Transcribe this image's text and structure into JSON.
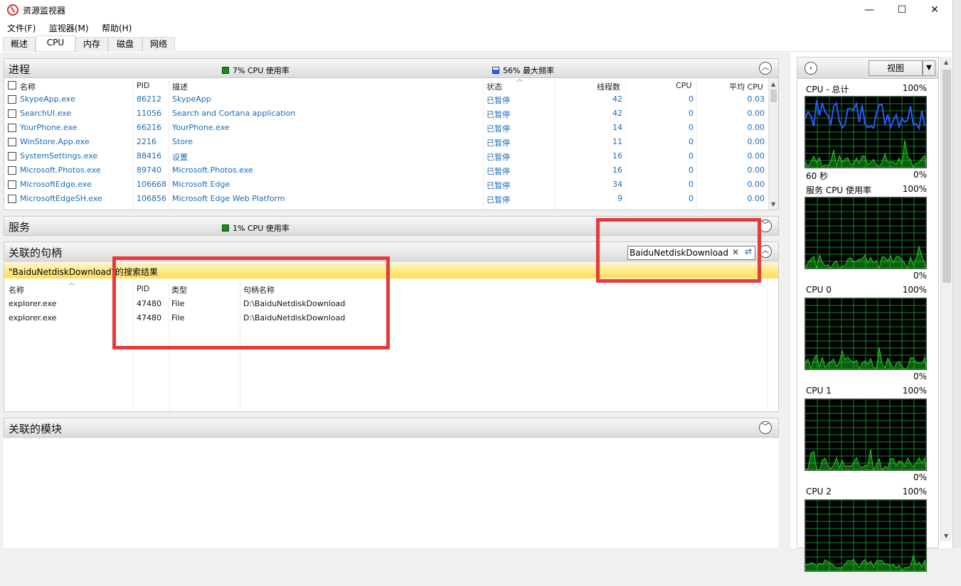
{
  "window": {
    "title": "资源监视器",
    "minimize": "—",
    "maximize": "☐",
    "close": "✕"
  },
  "menu": [
    "文件(F)",
    "监视器(M)",
    "帮助(H)"
  ],
  "tabs": [
    "概述",
    "CPU",
    "内存",
    "磁盘",
    "网络"
  ],
  "active_tab": "CPU",
  "processes": {
    "title": "进程",
    "cpu_usage": "7% CPU 使用率",
    "max_freq": "56% 最大频率",
    "columns": [
      "名称",
      "PID",
      "描述",
      "状态",
      "线程数",
      "CPU",
      "平均 CPU"
    ],
    "rows": [
      [
        "SkypeApp.exe",
        "86212",
        "SkypeApp",
        "已暂停",
        "42",
        "0",
        "0.03"
      ],
      [
        "SearchUI.exe",
        "11056",
        "Search and Cortana application",
        "已暂停",
        "42",
        "0",
        "0.00"
      ],
      [
        "YourPhone.exe",
        "66216",
        "YourPhone.exe",
        "已暂停",
        "14",
        "0",
        "0.00"
      ],
      [
        "WinStore.App.exe",
        "2216",
        "Store",
        "已暂停",
        "11",
        "0",
        "0.00"
      ],
      [
        "SystemSettings.exe",
        "88416",
        "设置",
        "已暂停",
        "16",
        "0",
        "0.00"
      ],
      [
        "Microsoft.Photos.exe",
        "89740",
        "Microsoft.Photos.exe",
        "已暂停",
        "16",
        "0",
        "0.00"
      ],
      [
        "MicrosoftEdge.exe",
        "106668",
        "Microsoft Edge",
        "已暂停",
        "34",
        "0",
        "0.00"
      ],
      [
        "MicrosoftEdgeSH.exe",
        "106856",
        "Microsoft Edge Web Platform",
        "已暂停",
        "9",
        "0",
        "0.00"
      ]
    ]
  },
  "services": {
    "title": "服务",
    "cpu_usage": "1% CPU 使用率"
  },
  "handles": {
    "title": "关联的句柄",
    "search_value": "BaiduNetdiskDownload",
    "search_result": "\"BaiduNetdiskDownload\"的搜索结果",
    "columns": [
      "名称",
      "PID",
      "类型",
      "句柄名称"
    ],
    "rows": [
      [
        "explorer.exe",
        "47480",
        "File",
        "D:\\BaiduNetdiskDownload"
      ],
      [
        "explorer.exe",
        "47480",
        "File",
        "D:\\BaiduNetdiskDownload"
      ]
    ]
  },
  "modules": {
    "title": "关联的模块"
  },
  "right_panel": {
    "view_label": "视图",
    "graphs": [
      {
        "label": "CPU - 总计",
        "max": "100%",
        "bottom_left": "60 秒",
        "bottom_right": "0%"
      },
      {
        "label": "服务 CPU 使用率",
        "max": "100%",
        "bottom_left": "",
        "bottom_right": "0%"
      },
      {
        "label": "CPU 0",
        "max": "100%",
        "bottom_left": "",
        "bottom_right": "0%"
      },
      {
        "label": "CPU 1",
        "max": "100%",
        "bottom_left": "",
        "bottom_right": "0%"
      },
      {
        "label": "CPU 2",
        "max": "100%",
        "bottom_left": "",
        "bottom_right": ""
      }
    ]
  },
  "colors": {
    "graph_bg": "#000000",
    "grid": "#0a8a2a",
    "cpu_line": "#2a5bff",
    "cpu_fill": "#20d020",
    "highlight": "#e63b3b"
  }
}
